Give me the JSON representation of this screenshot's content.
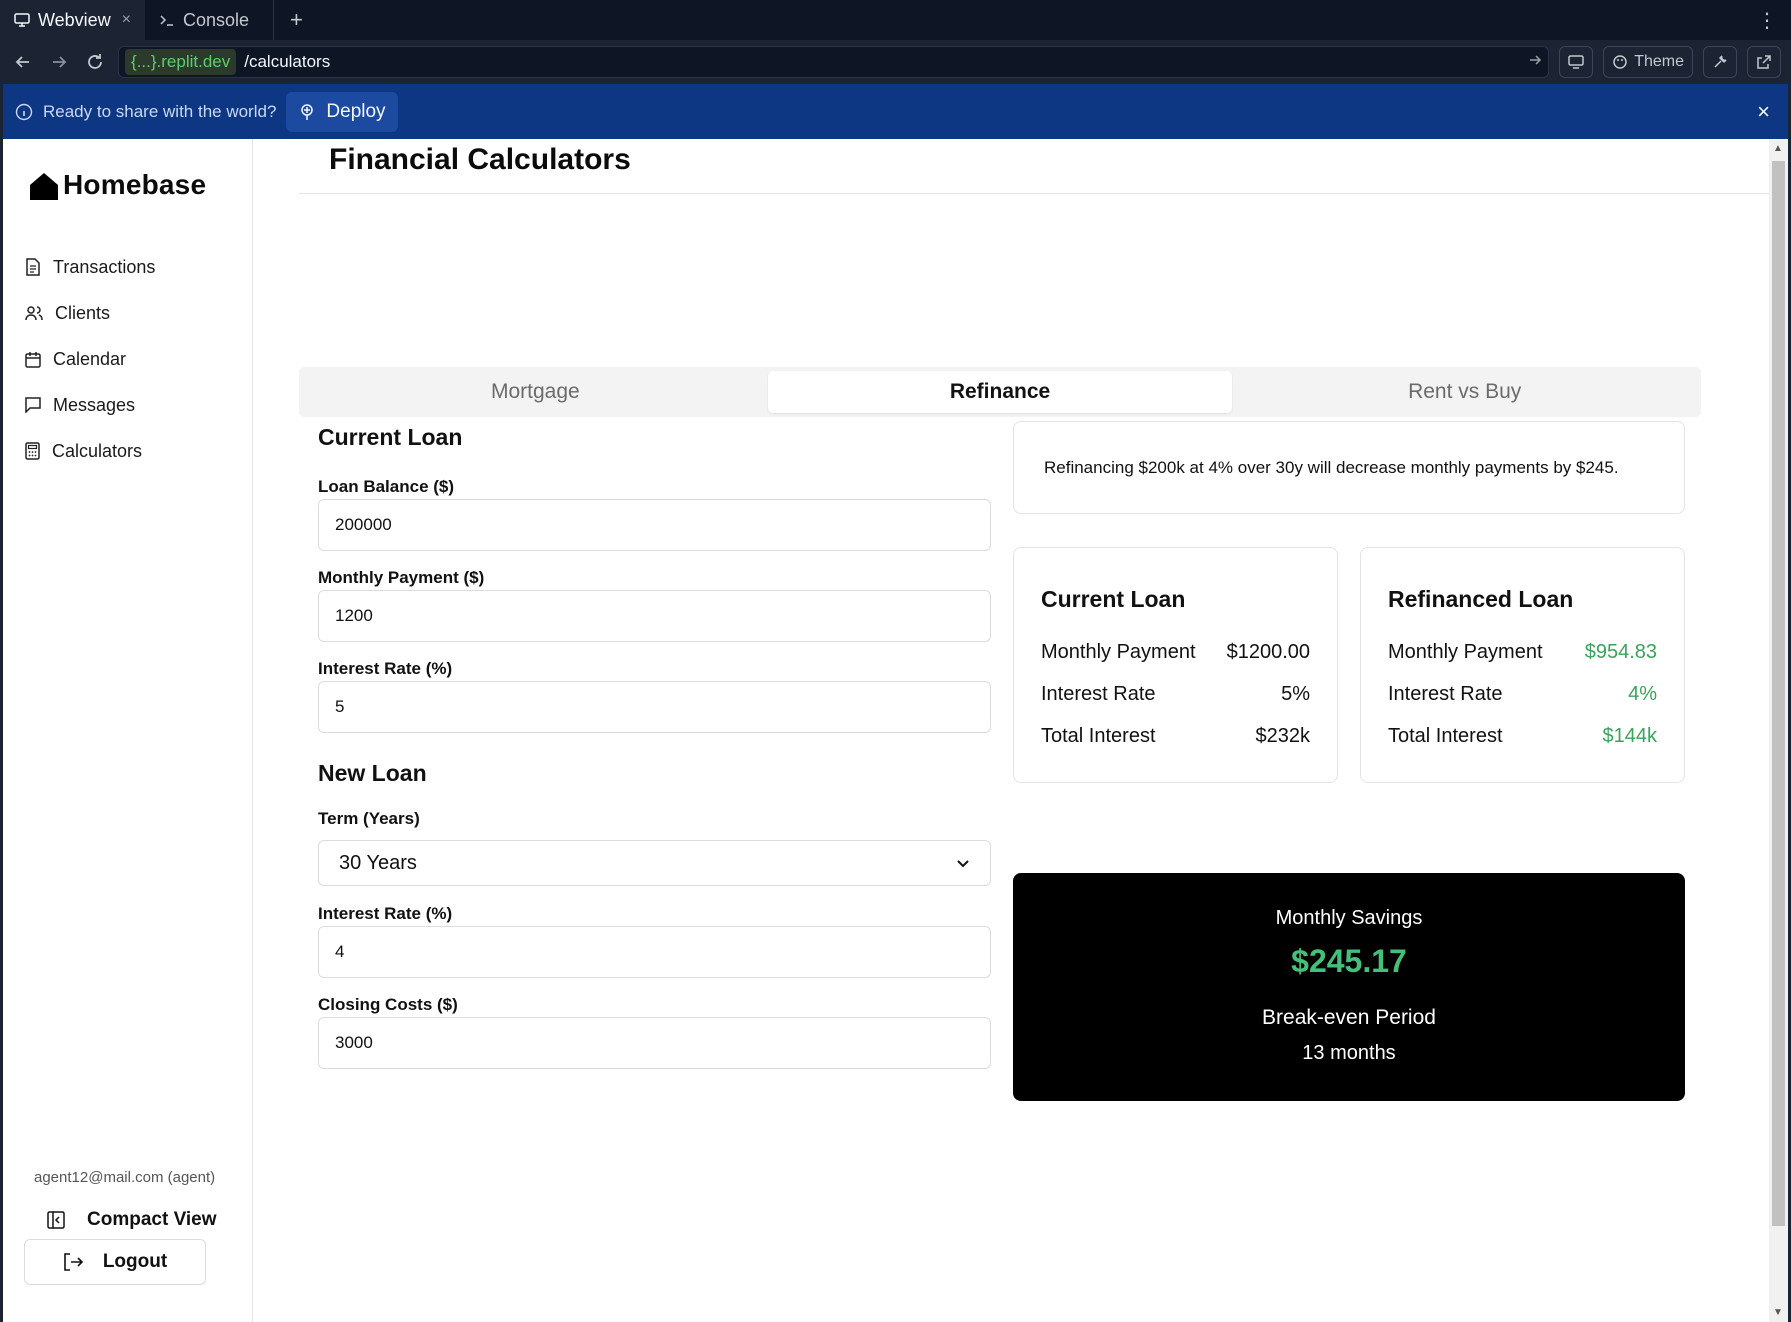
{
  "browser": {
    "tabs": [
      {
        "label": "Webview",
        "close": "×"
      },
      {
        "label": "Console"
      }
    ],
    "add_tab": "+",
    "kebab": "⋮",
    "domain": "{...}.replit.dev",
    "path": "/calculators",
    "theme_label": "Theme"
  },
  "banner": {
    "message": "Ready to share with the world?",
    "deploy_label": "Deploy",
    "close": "×"
  },
  "sidebar": {
    "brand": "Homebase",
    "items": [
      {
        "label": "Transactions",
        "icon": "file-text-icon"
      },
      {
        "label": "Clients",
        "icon": "users-icon"
      },
      {
        "label": "Calendar",
        "icon": "calendar-icon"
      },
      {
        "label": "Messages",
        "icon": "message-icon"
      },
      {
        "label": "Calculators",
        "icon": "calculator-icon"
      }
    ],
    "user_email": "agent12@mail.com (agent)",
    "compact_view": "Compact View",
    "logout": "Logout"
  },
  "page": {
    "title": "Financial Calculators",
    "tabs": [
      "Mortgage",
      "Refinance",
      "Rent vs Buy"
    ],
    "active_tab": "Refinance"
  },
  "form": {
    "current_loan_title": "Current Loan",
    "loan_balance_label": "Loan Balance ($)",
    "loan_balance_value": "200000",
    "monthly_payment_label": "Monthly Payment ($)",
    "monthly_payment_value": "1200",
    "interest_rate_label": "Interest Rate (%)",
    "interest_rate_value": "5",
    "new_loan_title": "New Loan",
    "term_label": "Term (Years)",
    "term_value": "30 Years",
    "new_rate_label": "Interest Rate (%)",
    "new_rate_value": "4",
    "closing_costs_label": "Closing Costs ($)",
    "closing_costs_value": "3000"
  },
  "results": {
    "summary": "Refinancing $200k at 4% over 30y will decrease monthly payments by $245.",
    "current": {
      "title": "Current Loan",
      "monthly_payment_label": "Monthly Payment",
      "monthly_payment": "$1200.00",
      "interest_rate_label": "Interest Rate",
      "interest_rate": "5%",
      "total_interest_label": "Total Interest",
      "total_interest": "$232k"
    },
    "refinanced": {
      "title": "Refinanced Loan",
      "monthly_payment_label": "Monthly Payment",
      "monthly_payment": "$954.83",
      "interest_rate_label": "Interest Rate",
      "interest_rate": "4%",
      "total_interest_label": "Total Interest",
      "total_interest": "$144k"
    },
    "savings": {
      "monthly_label": "Monthly Savings",
      "monthly_value": "$245.17",
      "breakeven_label": "Break-even Period",
      "breakeven_value": "13 months"
    }
  },
  "colors": {
    "accent_green": "#43c07a",
    "banner_blue": "#0d3782"
  }
}
